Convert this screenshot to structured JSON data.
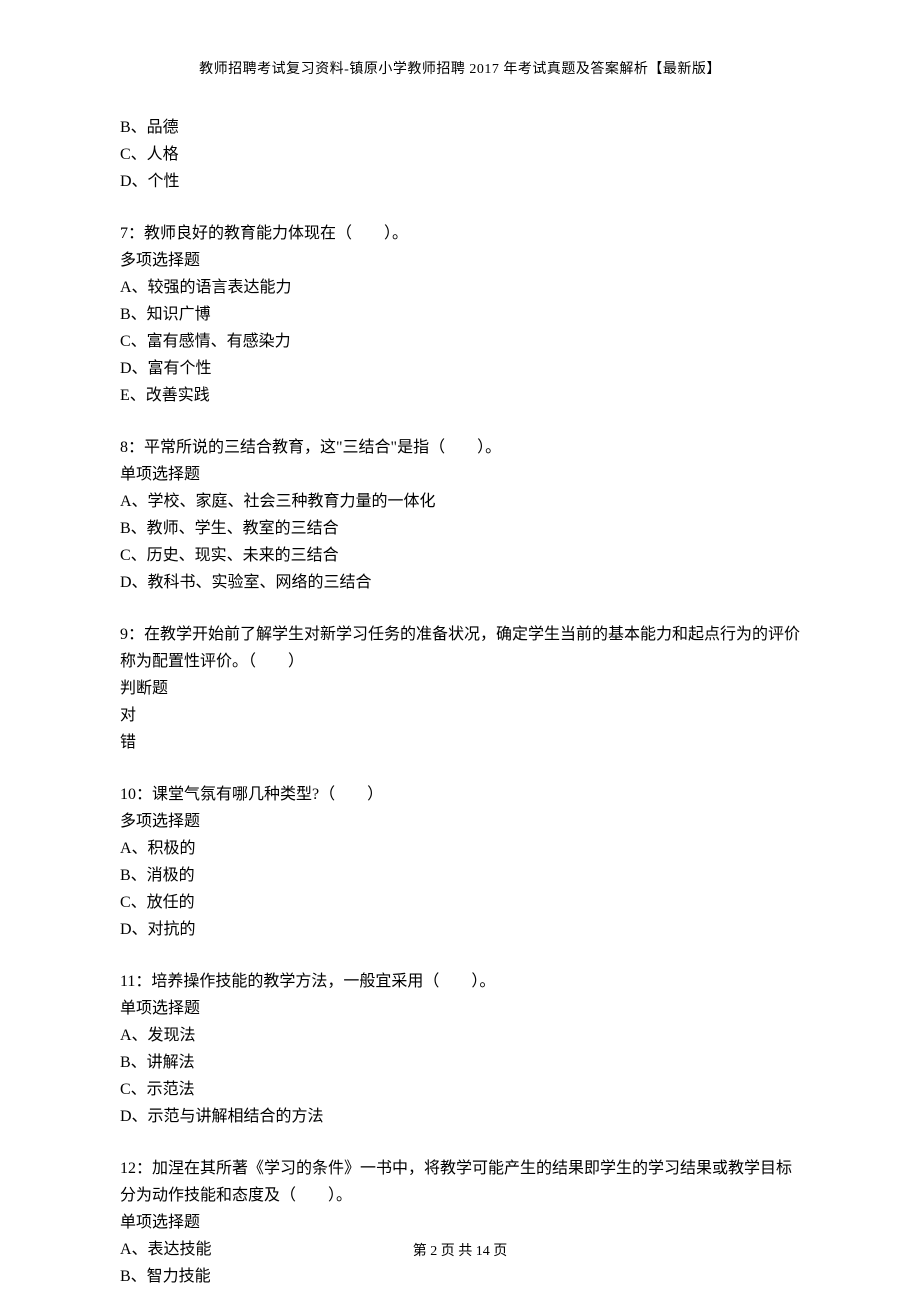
{
  "header": "教师招聘考试复习资料-镇原小学教师招聘 2017 年考试真题及答案解析【最新版】",
  "footer": "第 2 页 共 14 页",
  "q6_tail": {
    "opts": [
      "B、品德",
      "C、人格",
      "D、个性"
    ]
  },
  "q7": {
    "stem": "7：教师良好的教育能力体现在（　　）。",
    "type": "多项选择题",
    "opts": [
      "A、较强的语言表达能力",
      "B、知识广博",
      "C、富有感情、有感染力",
      "D、富有个性",
      "E、改善实践"
    ]
  },
  "q8": {
    "stem": "8：平常所说的三结合教育，这\"三结合\"是指（　　）。",
    "type": "单项选择题",
    "opts": [
      "A、学校、家庭、社会三种教育力量的一体化",
      "B、教师、学生、教室的三结合",
      "C、历史、现实、未来的三结合",
      "D、教科书、实验室、网络的三结合"
    ]
  },
  "q9": {
    "stem": "9：在教学开始前了解学生对新学习任务的准备状况，确定学生当前的基本能力和起点行为的评价称为配置性评价。（　　）",
    "type": "判断题",
    "opts": [
      "对",
      "错"
    ]
  },
  "q10": {
    "stem": "10：课堂气氛有哪几种类型?（　　）",
    "type": "多项选择题",
    "opts": [
      "A、积极的",
      "B、消极的",
      "C、放任的",
      "D、对抗的"
    ]
  },
  "q11": {
    "stem": "11：培养操作技能的教学方法，一般宜采用（　　）。",
    "type": "单项选择题",
    "opts": [
      "A、发现法",
      "B、讲解法",
      "C、示范法",
      "D、示范与讲解相结合的方法"
    ]
  },
  "q12": {
    "stem": "12：加涅在其所著《学习的条件》一书中，将教学可能产生的结果即学生的学习结果或教学目标分为动作技能和态度及（　　）。",
    "type": "单项选择题",
    "opts": [
      "A、表达技能",
      "B、智力技能"
    ]
  }
}
